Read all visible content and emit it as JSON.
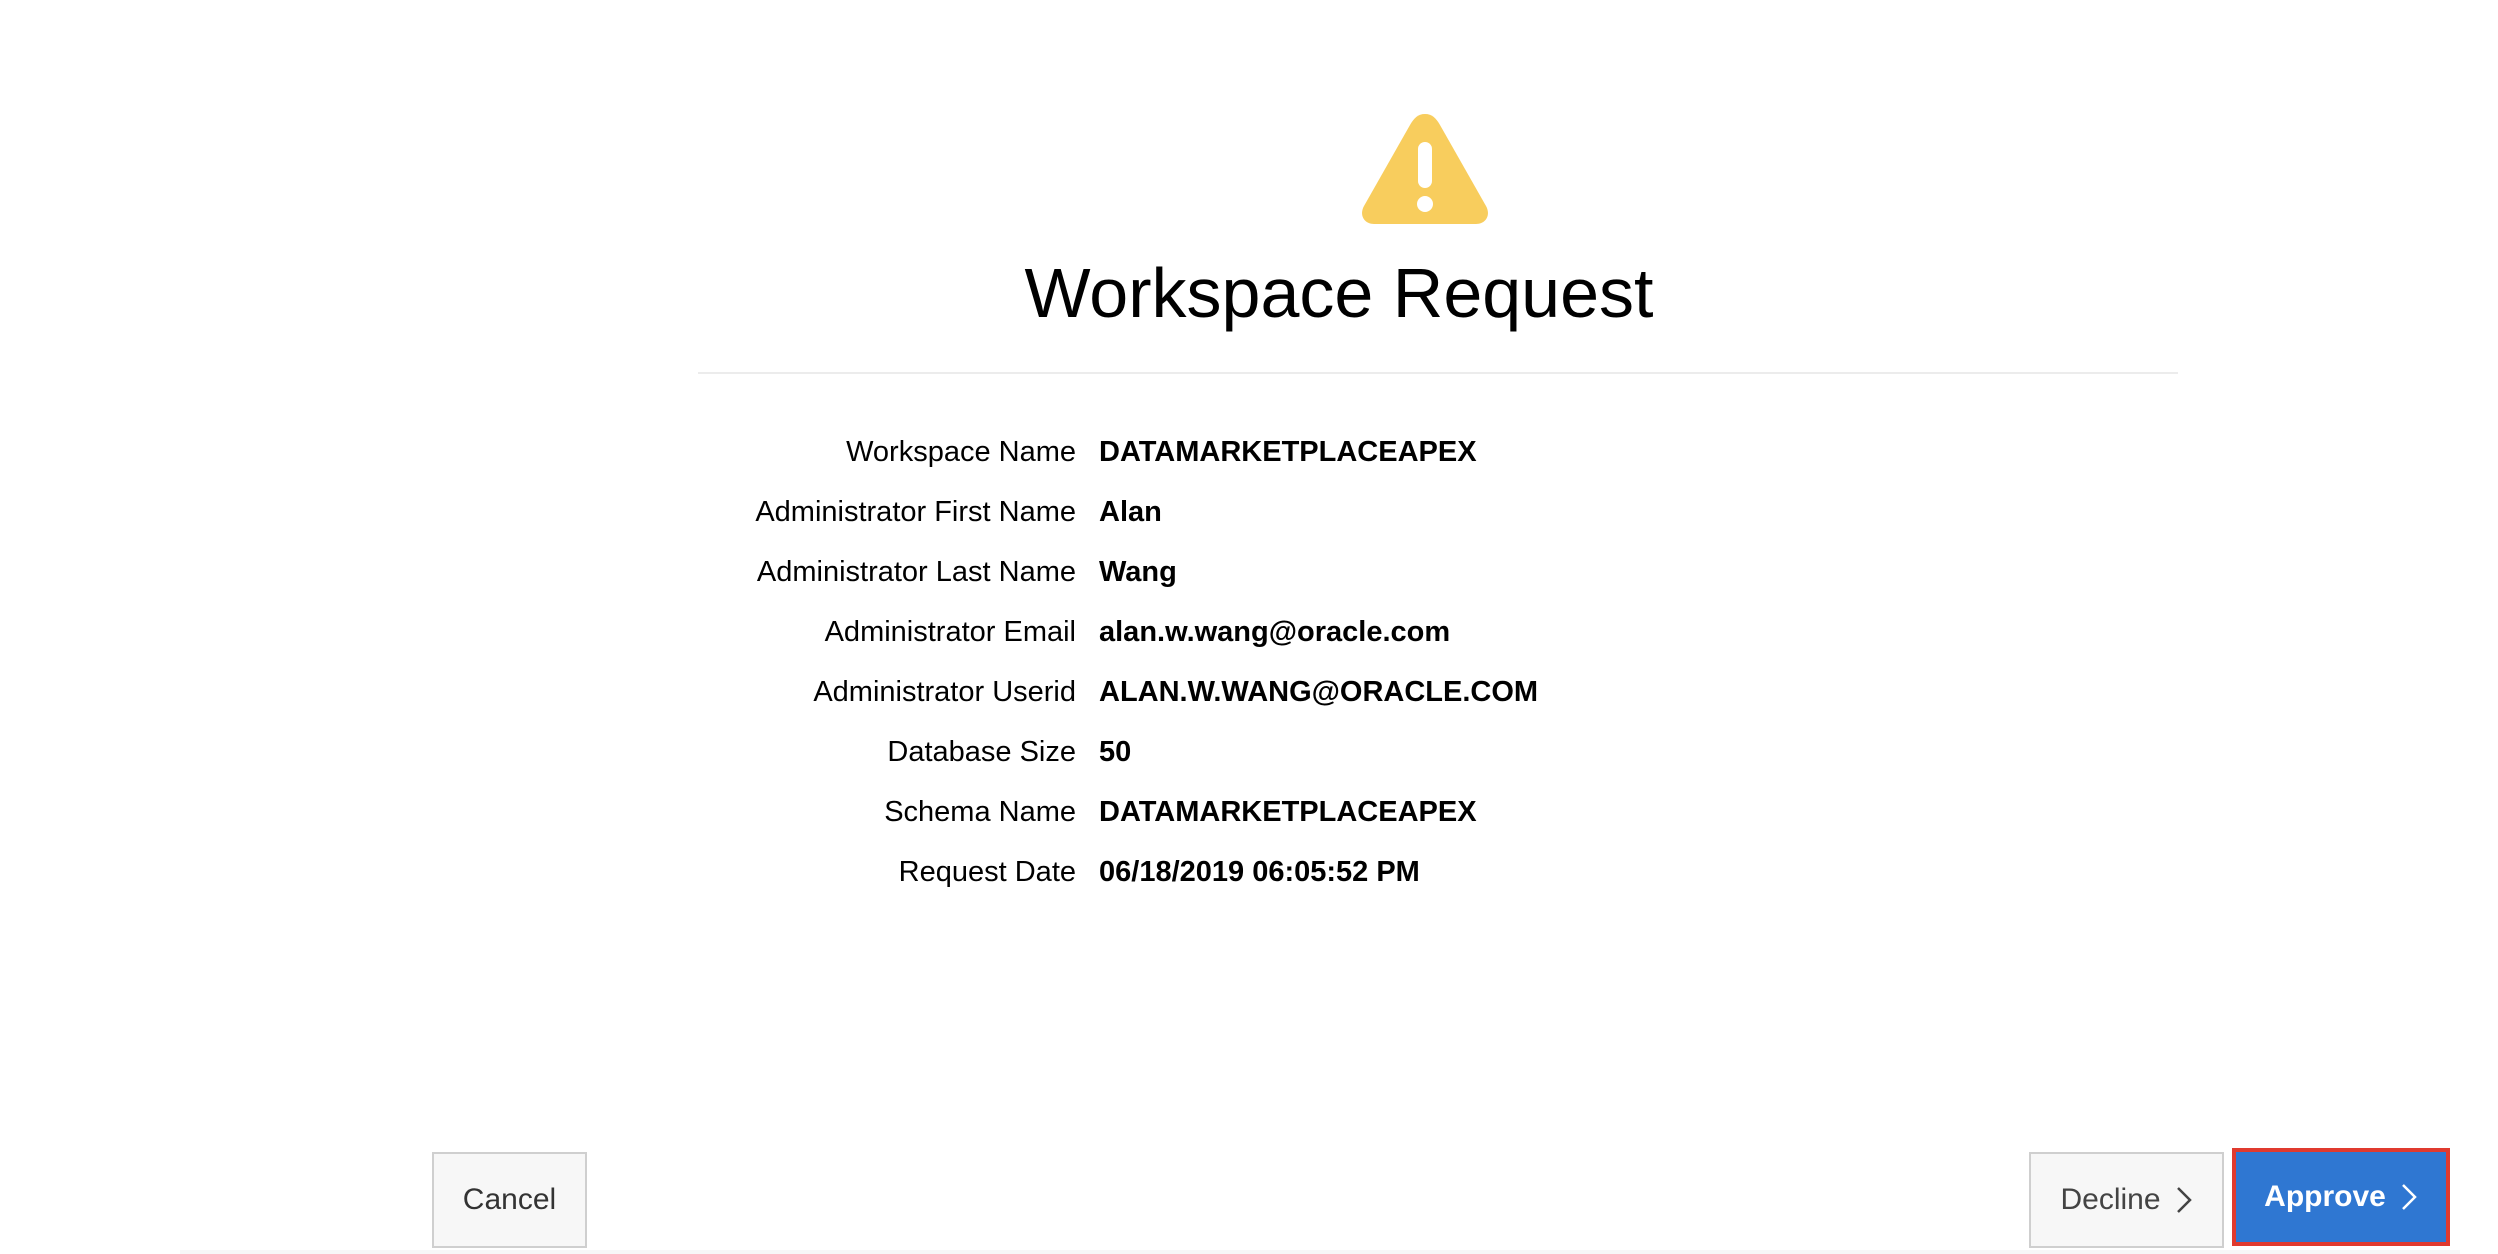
{
  "header": {
    "icon": "warning-triangle-icon",
    "icon_color": "#f8cd5d",
    "title": "Workspace Request"
  },
  "details": [
    {
      "label": "Workspace Name",
      "value": "DATAMARKETPLACEAPEX"
    },
    {
      "label": "Administrator First Name",
      "value": "Alan"
    },
    {
      "label": "Administrator Last Name",
      "value": "Wang"
    },
    {
      "label": "Administrator Email",
      "value": "alan.w.wang@oracle.com"
    },
    {
      "label": "Administrator Userid",
      "value": "ALAN.W.WANG@ORACLE.COM"
    },
    {
      "label": "Database Size",
      "value": "50"
    },
    {
      "label": "Schema Name",
      "value": "DATAMARKETPLACEAPEX"
    },
    {
      "label": "Request Date",
      "value": "06/18/2019 06:05:52 PM"
    }
  ],
  "buttons": {
    "cancel_label": "Cancel",
    "decline_label": "Decline",
    "approve_label": "Approve",
    "approve_color": "#2f77d2",
    "highlight_color": "#e03a2f"
  }
}
